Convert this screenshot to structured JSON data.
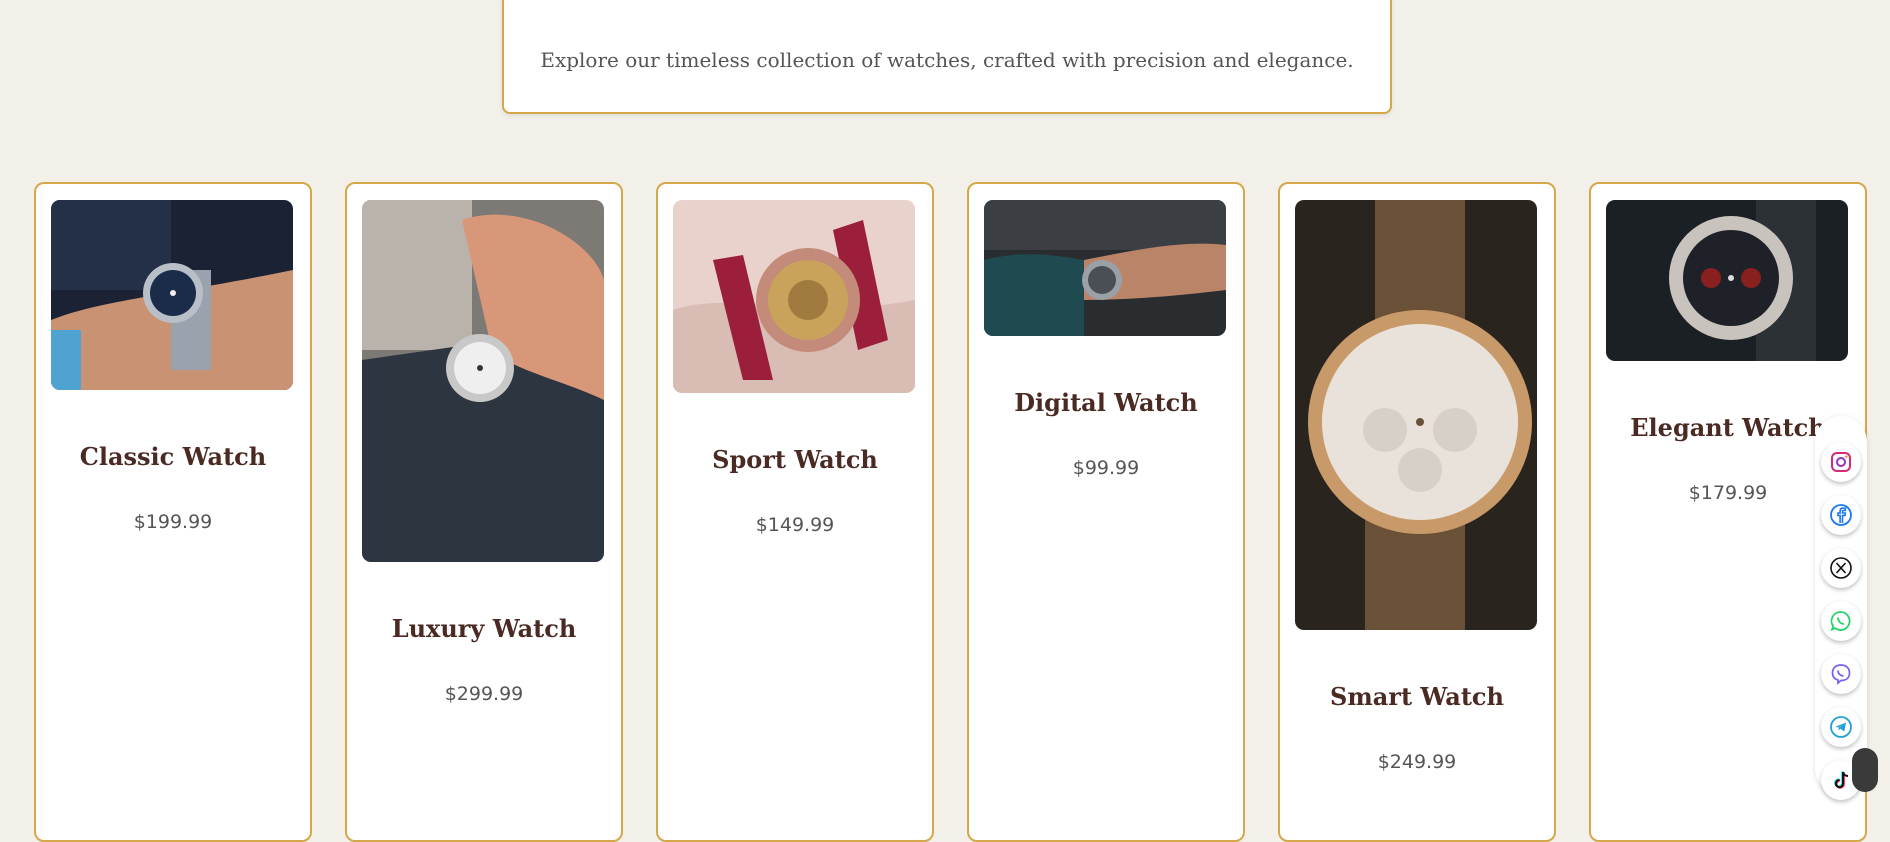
{
  "intro": {
    "text": "Explore our timeless collection of watches, crafted with precision and elegance."
  },
  "products": [
    {
      "name": "Classic Watch",
      "price": "$199.99"
    },
    {
      "name": "Luxury Watch",
      "price": "$299.99"
    },
    {
      "name": "Sport Watch",
      "price": "$149.99"
    },
    {
      "name": "Digital Watch",
      "price": "$99.99"
    },
    {
      "name": "Smart Watch",
      "price": "$249.99"
    },
    {
      "name": "Elegant Watch",
      "price": "$179.99"
    }
  ],
  "social": [
    {
      "icon": "instagram-icon",
      "color": "#d62976"
    },
    {
      "icon": "facebook-icon",
      "color": "#1877f2"
    },
    {
      "icon": "x-icon",
      "color": "#111111"
    },
    {
      "icon": "whatsapp-icon",
      "color": "#25d366"
    },
    {
      "icon": "viber-icon",
      "color": "#7360f2"
    },
    {
      "icon": "telegram-icon",
      "color": "#229ed9"
    },
    {
      "icon": "tiktok-icon",
      "color": "#111111"
    }
  ],
  "colors": {
    "accent": "#d4a84a",
    "background": "#f3f0ea",
    "title": "#4a2a22"
  }
}
